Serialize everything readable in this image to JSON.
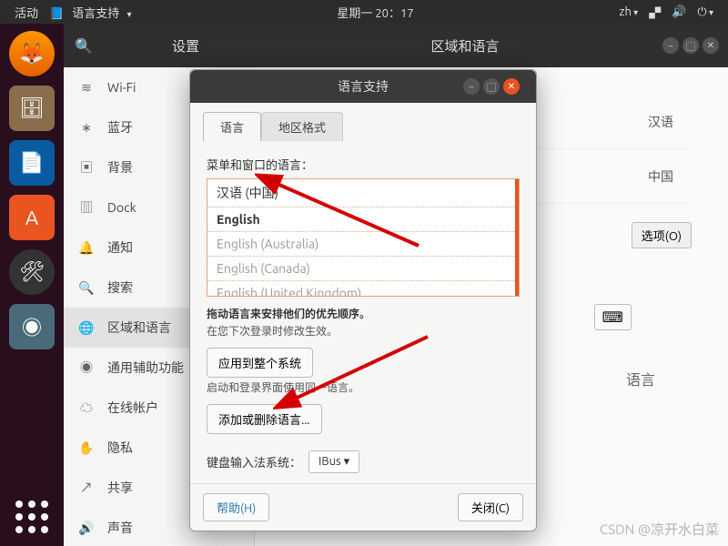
{
  "toppanel": {
    "activities": "活动",
    "app_indicator": "语言支持",
    "datetime": "星期一 20：17",
    "ime": "zh"
  },
  "settings": {
    "sidebar_title": "设置",
    "main_title": "区域和语言",
    "sidebar": [
      {
        "icon": "wifi",
        "label": "Wi-Fi"
      },
      {
        "icon": "bt",
        "label": "蓝牙"
      },
      {
        "icon": "bg",
        "label": "背景"
      },
      {
        "icon": "dock",
        "label": "Dock"
      },
      {
        "icon": "notif",
        "label": "通知"
      },
      {
        "icon": "search",
        "label": "搜索"
      },
      {
        "icon": "region",
        "label": "区域和语言"
      },
      {
        "icon": "a11y",
        "label": "通用辅助功能"
      },
      {
        "icon": "online",
        "label": "在线帐户"
      },
      {
        "icon": "privacy",
        "label": "隐私"
      },
      {
        "icon": "share",
        "label": "共享"
      },
      {
        "icon": "sound",
        "label": "声音"
      }
    ],
    "main": {
      "lang_value": "汉语",
      "region_value": "中国",
      "options_btn": "选项(O)",
      "input_lang_label": "语言"
    }
  },
  "dialog": {
    "title": "语言支持",
    "tabs": [
      "语言",
      "地区格式"
    ],
    "list_label": "菜单和窗口的语言：",
    "languages": [
      {
        "label": "汉语 (中国)",
        "style": "sel"
      },
      {
        "label": "English",
        "style": "bold"
      },
      {
        "label": "English (Australia)",
        "style": "gray"
      },
      {
        "label": "English (Canada)",
        "style": "gray"
      },
      {
        "label": "English (United Kingdom)",
        "style": "gray"
      }
    ],
    "hint_bold": "拖动语言来安排他们的优先顺序。",
    "hint_sub": "在您下次登录时修改生效。",
    "apply_system": "应用到整个系统",
    "apply_sub": "启动和登录界面使用同一语言。",
    "add_remove": "添加或删除语言...",
    "ime_label": "键盘输入法系统：",
    "ime_value": "IBus",
    "help": "帮助(H)",
    "close": "关闭(C)"
  },
  "watermark": "CSDN @凉开水白菜"
}
